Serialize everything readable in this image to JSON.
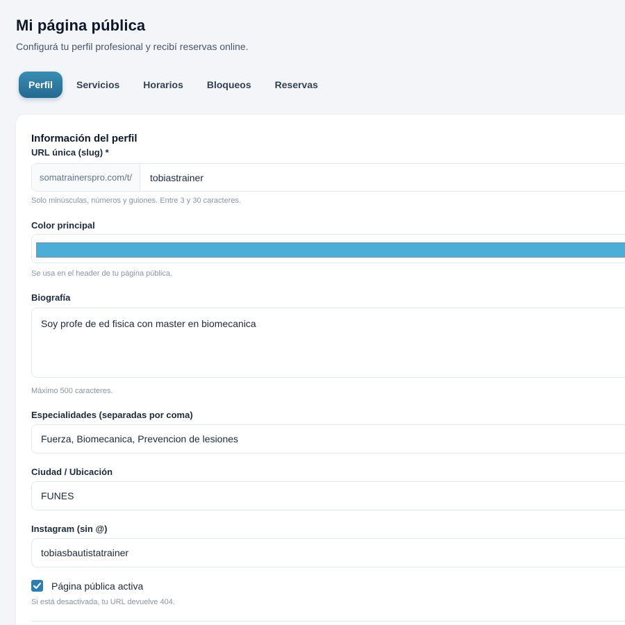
{
  "header": {
    "title": "Mi página pública",
    "subtitle": "Configurá tu perfil profesional y recibí reservas online."
  },
  "tabs": [
    {
      "label": "Perfil",
      "active": true
    },
    {
      "label": "Servicios",
      "active": false
    },
    {
      "label": "Horarios",
      "active": false
    },
    {
      "label": "Bloqueos",
      "active": false
    },
    {
      "label": "Reservas",
      "active": false
    }
  ],
  "profile": {
    "section_title": "Información del perfil",
    "slug": {
      "label": "URL única (slug) *",
      "prefix": "somatrainerspro.com/t/",
      "value": "tobiastrainer",
      "hint": "Solo minúsculas, números y guiones. Entre 3 y 30 caracteres."
    },
    "color": {
      "label": "Color principal",
      "value": "#4aaed6",
      "hint": "Se usa en el header de tu página pública."
    },
    "bio": {
      "label": "Biografía",
      "value": "Soy profe de ed fisica con master en biomecanica",
      "hint": "Máximo 500 caracteres."
    },
    "specialties": {
      "label": "Especialidades (separadas por coma)",
      "value": "Fuerza, Biomecanica, Prevencion de lesiones"
    },
    "city": {
      "label": "Ciudad / Ubicación",
      "value": "FUNES"
    },
    "instagram": {
      "label": "Instagram (sin @)",
      "value": "tobiasbautistatrainer"
    },
    "active": {
      "label": "Página pública activa",
      "checked": true,
      "hint": "Si está desactivada, tu URL devuelve 404."
    }
  },
  "colors": {
    "accent": "#2b7db2",
    "tab_active": "#2f7aa3"
  },
  "icons": {
    "checkbox": "checkmark-icon"
  }
}
